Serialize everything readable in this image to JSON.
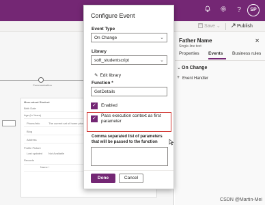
{
  "topbar": {
    "icons": [
      "notification-icon",
      "settings-icon",
      "help-icon"
    ],
    "avatar_initials": "SP"
  },
  "cmdbar": {
    "save_label": "Save",
    "publish_label": "Publish"
  },
  "canvas": {
    "stage_label": "Communication",
    "section_header": "More about Student",
    "rows": [
      {
        "label": "Birth Date",
        "value": ""
      },
      {
        "label": "Age (in Years)",
        "value": ""
      },
      {
        "label": "Phone/Info",
        "value": "The current set of home phone"
      },
      {
        "label": "Blog",
        "value": ""
      },
      {
        "label": "Address",
        "value": ""
      },
      {
        "label": "Profile Picture",
        "value": ""
      },
      {
        "label": "Last updated",
        "value": "Not Available"
      }
    ],
    "subgrid_title": "Records",
    "subgrid_col": "Name ↑"
  },
  "rpanel": {
    "title": "Father Name",
    "subtitle": "Single-line text",
    "close_glyph": "✕",
    "tabs": [
      "Properties",
      "Events",
      "Business rules"
    ],
    "active_tab": "Events",
    "section": "On Change",
    "chevron": "⌄",
    "add_glyph": "+",
    "event_handler": "Event Handler"
  },
  "dialog": {
    "title": "Configure Event",
    "event_type_label": "Event Type",
    "event_type_value": "On Change",
    "library_label": "Library",
    "library_value": "soft_studentscript",
    "edit_library": "Edit library",
    "function_label": "Function *",
    "function_value": "GetDetails",
    "enabled_label": "Enabled",
    "pass_context_label_1": "Pass execution context as first",
    "pass_context_label_2": "parameter",
    "params_label": "Comma separated list of parameters that will be passed to the function",
    "params_value": "",
    "done_label": "Done",
    "cancel_label": "Cancel",
    "check_glyph": "✓",
    "chevron_glyph": "⌄"
  },
  "watermark": "CSDN @Martin-Mei",
  "colors": {
    "brand": "#742774",
    "highlight": "#d0312d"
  }
}
